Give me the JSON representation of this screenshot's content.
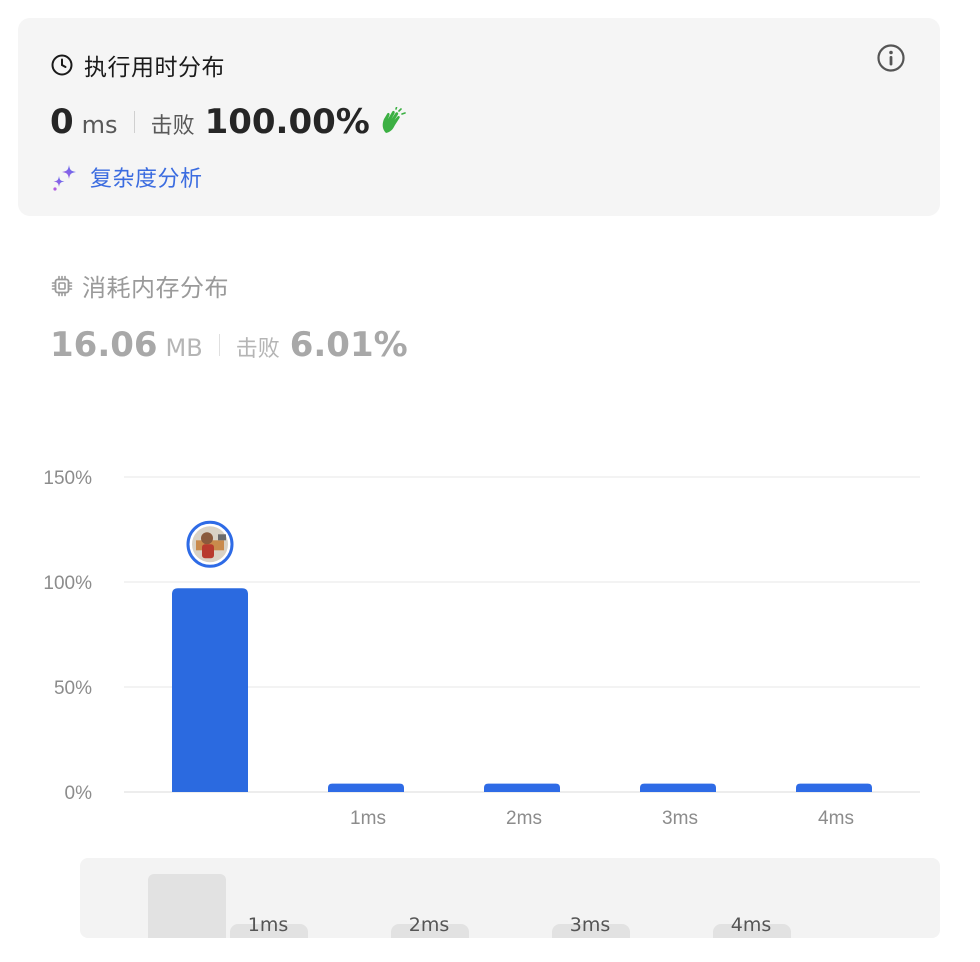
{
  "runtime": {
    "title": "执行用时分布",
    "value": "0",
    "unit": "ms",
    "beats_label": "击败",
    "beats_pct": "100.00%",
    "complexity_link": "复杂度分析"
  },
  "memory": {
    "title": "消耗内存分布",
    "value": "16.06",
    "unit": "MB",
    "beats_label": "击败",
    "beats_pct": "6.01%"
  },
  "colors": {
    "bar": "#2e6be6",
    "accent_link": "#3b6ce0",
    "card_bg": "#f5f5f5",
    "clap_icon": "#3cb043"
  },
  "icons": {
    "clock": "clock-icon",
    "info": "info-icon",
    "sparkle": "sparkle-icon",
    "clap": "clapping-hands-icon",
    "chip": "chip-icon",
    "avatar": "user-avatar"
  },
  "chart_data": {
    "type": "bar",
    "categories": [
      "",
      "1ms",
      "2ms",
      "3ms",
      "4ms"
    ],
    "values": [
      97,
      4,
      4,
      4,
      4
    ],
    "ylim": [
      0,
      150
    ],
    "yticks": [
      "0%",
      "50%",
      "100%",
      "150%"
    ],
    "ytick_values": [
      0,
      50,
      100,
      150
    ],
    "grid": true,
    "highlighted_index": 0
  },
  "scrubber": {
    "labels": [
      "1ms",
      "2ms",
      "3ms",
      "4ms"
    ]
  }
}
